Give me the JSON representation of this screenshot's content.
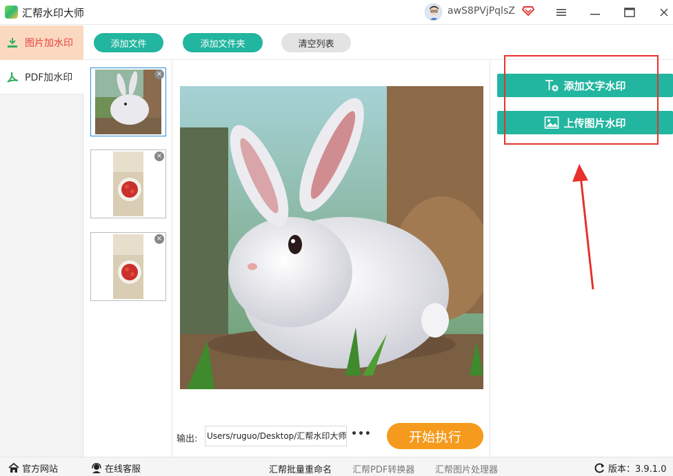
{
  "app": {
    "title": "汇帮水印大师",
    "username": "awS8PVjPqlsZ"
  },
  "colors": {
    "accent": "#22b59f",
    "start": "#f59a1c",
    "active_nav_bg": "#fbd9c1",
    "active_nav_text": "#e8413a",
    "highlight": "#e8312c"
  },
  "sidebar": {
    "items": [
      {
        "label": "图片加水印",
        "icon": "image-watermark-icon",
        "active": true
      },
      {
        "label": "PDF加水印",
        "icon": "pdf-icon",
        "active": false
      }
    ]
  },
  "toolbar": {
    "add_file": "添加文件",
    "add_folder": "添加文件夹",
    "clear_list": "清空列表"
  },
  "thumbnails": [
    {
      "name": "rabbit",
      "selected": true
    },
    {
      "name": "strawberries-1",
      "selected": false
    },
    {
      "name": "strawberries-2",
      "selected": false
    }
  ],
  "output": {
    "label": "输出:",
    "path": "Users/ruguo/Desktop/汇帮水印大师",
    "more": "•••",
    "start": "开始执行"
  },
  "watermark": {
    "add_text": "添加文字水印",
    "upload_image": "上传图片水印"
  },
  "statusbar": {
    "website": "官方网站",
    "support": "在线客服",
    "links": [
      "汇帮批量重命名",
      "汇帮PDF转换器",
      "汇帮图片处理器"
    ],
    "version": "版本：3.9.1.0"
  }
}
